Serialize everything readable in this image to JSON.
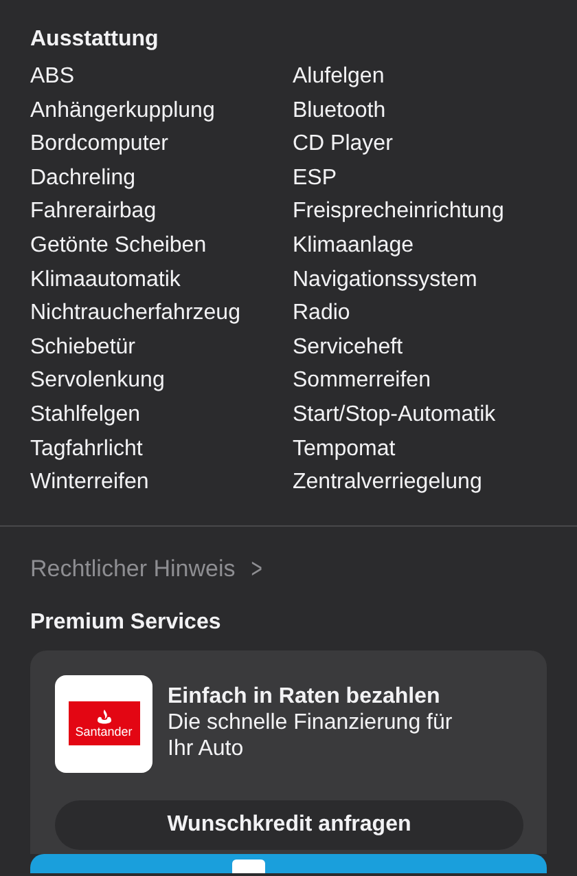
{
  "equipment": {
    "title": "Ausstattung",
    "items": [
      "ABS",
      "Alufelgen",
      "Anhängerkupplung",
      "Bluetooth",
      "Bordcomputer",
      "CD Player",
      "Dachreling",
      "ESP",
      "Fahrerairbag",
      "Freisprecheinrichtung",
      "Getönte Scheiben",
      "Klimaanlage",
      "Klimaautomatik",
      "Navigationssystem",
      "Nichtraucherfahrzeug",
      "Radio",
      "Schiebetür",
      "Serviceheft",
      "Servolenkung",
      "Sommerreifen",
      "Stahlfelgen",
      "Start/Stop-Automatik",
      "Tagfahrlicht",
      "Tempomat",
      "Winterreifen",
      "Zentralverriegelung"
    ]
  },
  "legal_link": {
    "label": "Rechtlicher Hinweis",
    "chevron": ">"
  },
  "premium": {
    "title": "Premium Services",
    "card": {
      "logo": "Santander",
      "headline": "Einfach in Raten bezahlen",
      "text": "Die schnelle Finanzierung für Ihr Auto",
      "button": "Wunschkredit anfragen"
    }
  }
}
